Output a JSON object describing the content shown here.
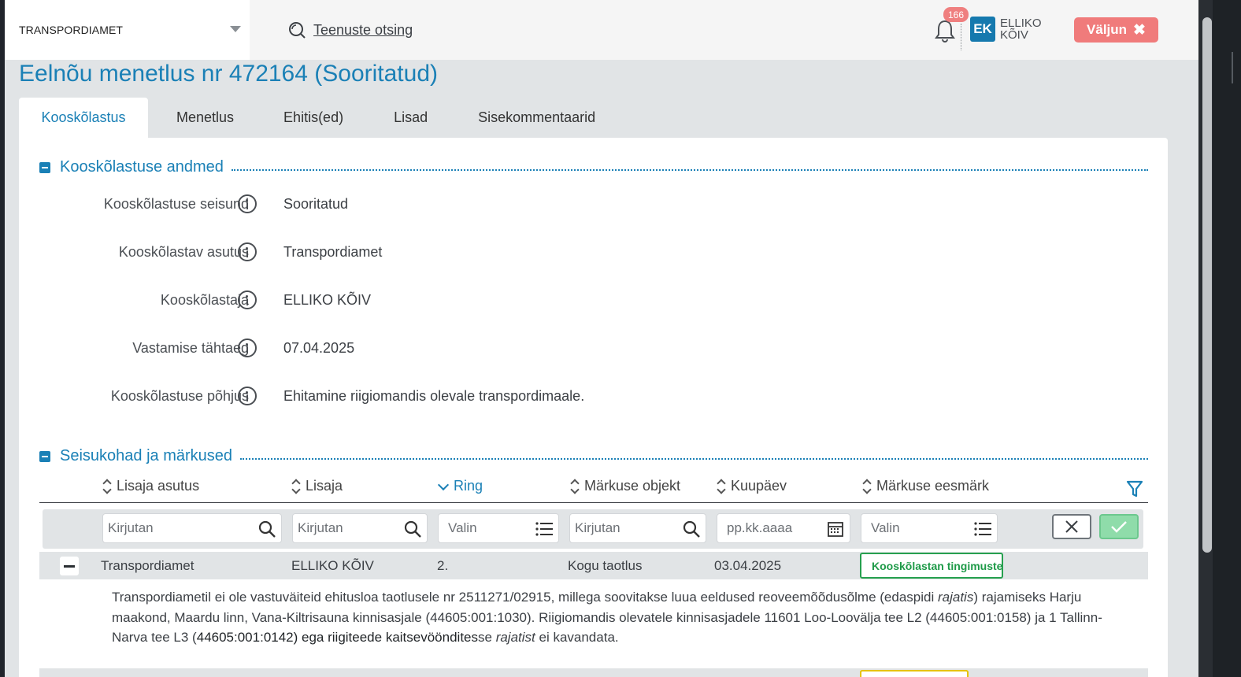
{
  "header": {
    "organization": "TRANSPORDIAMET",
    "search_label": "Teenuste otsing",
    "notification_count": "166",
    "user_initials": "EK",
    "user_name": "ELLIKO KÕIV",
    "logout_label": "Väljun"
  },
  "page": {
    "title": "Eelnõu menetlus nr 472164 (Sooritatud)"
  },
  "tabs": [
    {
      "label": "Kooskõlastus",
      "active": true
    },
    {
      "label": "Menetlus"
    },
    {
      "label": "Ehitis(ed)"
    },
    {
      "label": "Lisad"
    },
    {
      "label": "Sisekommentaarid"
    }
  ],
  "details": {
    "section_title": "Kooskõlastuse andmed",
    "fields": [
      {
        "label": "Kooskõlastuse seisund",
        "value": "Sooritatud"
      },
      {
        "label": "Kooskõlastav asutus",
        "value": "Transpordiamet"
      },
      {
        "label": "Kooskõlastaja",
        "value": "ELLIKO KÕIV"
      },
      {
        "label": "Vastamise tähtaeg",
        "value": "07.04.2025"
      },
      {
        "label": "Kooskõlastuse põhjus",
        "value": "Ehitamine riigiomandis olevale transpordimaale."
      }
    ]
  },
  "positions": {
    "section_title": "Seisukohad ja märkused",
    "columns": [
      "Lisaja asutus",
      "Lisaja",
      "Ring",
      "Märkuse objekt",
      "Kuupäev",
      "Märkuse eesmärk"
    ],
    "sorted_column": "Ring",
    "filters": {
      "institution_placeholder": "Kirjutan",
      "adder_placeholder": "Kirjutan",
      "ring_placeholder": "Valin",
      "object_placeholder": "Kirjutan",
      "date_placeholder": "pp.kk.aaaa",
      "purpose_placeholder": "Valin"
    },
    "rows": [
      {
        "institution": "Transpordiamet",
        "adder": "ELLIKO KÕIV",
        "ring": "2.",
        "object": "Kogu taotlus",
        "date": "03.04.2025",
        "purpose": "Kooskõlastan tingimusteta",
        "comment": {
          "p1": "Transpordiametil ei ole vastuväiteid ehitusloa taotlusele nr 2511271/02915, millega soovitakse luua eeldused reoveemõõdusõlme (edaspidi ",
          "i1": "rajatis",
          "p2": ") rajamiseks Harju maakond, Maardu linn, Vana-Kiltrisauna kinnisasjale (44605:001:1030). Riigiomandis olevatele kinnisasjadele 11601 Loo-Loovälja tee L2 (44605:001:0158) ja 1 Tallinn-Narva tee L3 (",
          "d1": "44605:001:0142) ega riigiteede kaitsevööndites",
          "p3": "se ",
          "i2": "rajatist",
          "p4": " ei kavandata."
        }
      }
    ]
  },
  "colors": {
    "brand": "#1a80b6",
    "logout": "#f07b7b",
    "status_green": "#26a04f",
    "status_yellow": "#e6c300"
  }
}
